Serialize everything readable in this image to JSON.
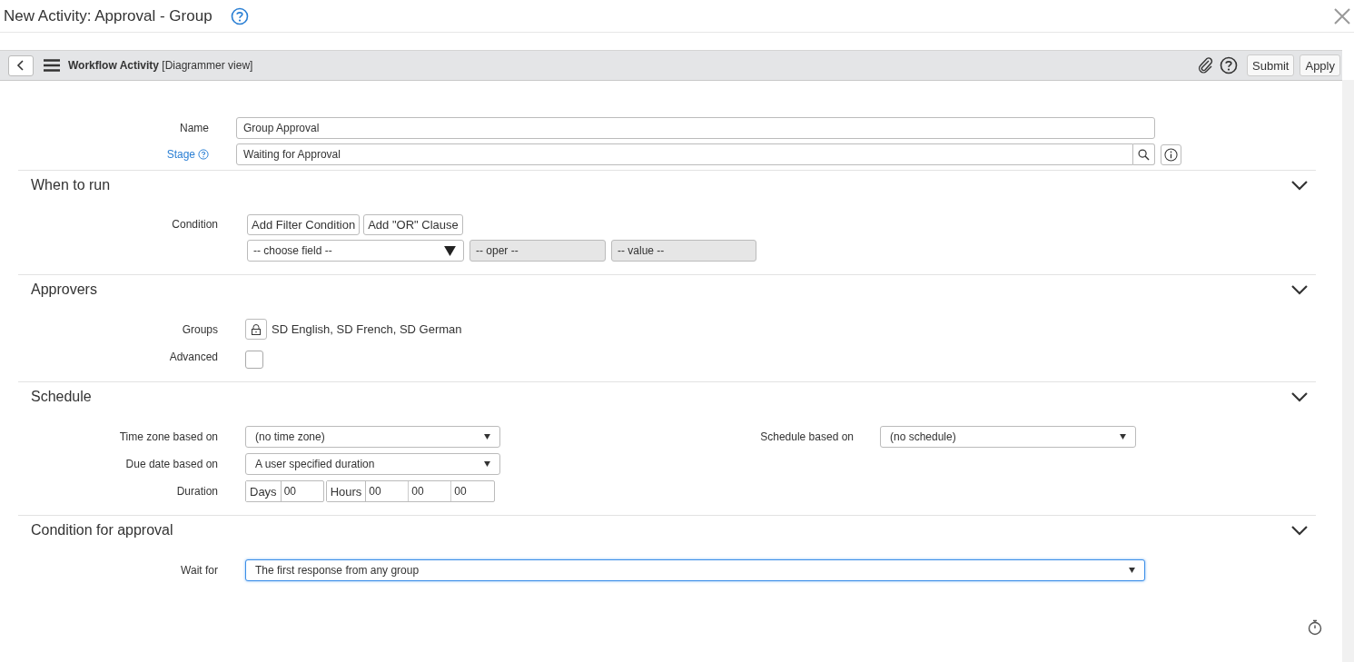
{
  "dialog": {
    "title": "New Activity: Approval - Group"
  },
  "header": {
    "title": "Workflow Activity",
    "subtitle": "[Diagrammer view]",
    "buttons": [
      "Submit",
      "Apply"
    ]
  },
  "fields": [
    {
      "label": "Name",
      "value": "Group Approval",
      "kind": "text"
    },
    {
      "label": "Stage",
      "value": "Waiting for Approval",
      "kind": "reference"
    }
  ],
  "sections": [
    {
      "title": "When to run",
      "expanded": true,
      "rows": [
        {
          "kind": "condition",
          "label": "Condition",
          "buttons": [
            "Add Filter Condition",
            "Add \"OR\" Clause"
          ],
          "field": "-- choose field --",
          "operator": "-- oper --",
          "value": "-- value --"
        }
      ]
    },
    {
      "title": "Approvers",
      "expanded": true,
      "rows": [
        {
          "kind": "locked_list",
          "label": "Groups",
          "value": "SD English, SD French, SD German"
        },
        {
          "kind": "checkbox",
          "label": "Advanced",
          "checked": false
        }
      ]
    },
    {
      "title": "Schedule",
      "expanded": true,
      "rows": [
        {
          "kind": "select",
          "label": "Time zone based on",
          "value": "(no time zone)",
          "focused": false,
          "side": {
            "label": "Schedule based on",
            "value": "(no schedule)"
          }
        },
        {
          "kind": "select",
          "label": "Due date based on",
          "value": "A user specified duration",
          "focused": false
        },
        {
          "kind": "duration",
          "label": "Duration",
          "days_label": "Days",
          "days": "00",
          "hours_label": "Hours",
          "hours": [
            "00",
            "00",
            "00"
          ]
        }
      ]
    },
    {
      "title": "Condition for approval",
      "expanded": true,
      "rows": [
        {
          "kind": "select",
          "label": "Wait for",
          "value": "The first response from any group",
          "focused": true,
          "wide": true
        }
      ]
    }
  ]
}
